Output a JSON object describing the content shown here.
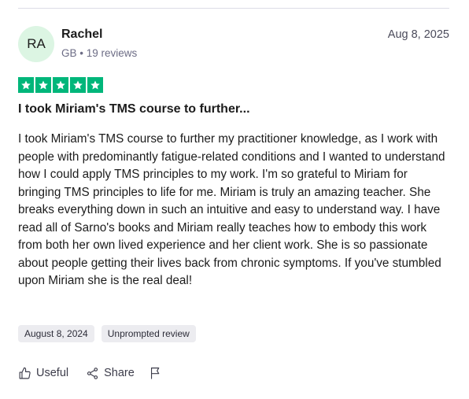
{
  "review": {
    "reviewer": {
      "initials": "RA",
      "name": "Rachel",
      "meta": "GB • 19 reviews"
    },
    "date": "Aug 8, 2025",
    "rating": 5,
    "title": "I took Miriam's TMS course to further...",
    "body": "I took Miriam's TMS course to further my practitioner knowledge, as I work with people with predominantly fatigue-related conditions and I wanted to understand how I could apply TMS principles to my work. I'm so grateful to Miriam for bringing TMS principles to life for me. Miriam is truly an amazing teacher. She breaks everything down in such an intuitive and easy to understand way. I have read all of Sarno's books and Miriam really teaches how to embody this work from both her own lived experience and her client work. She is so passionate about people getting their lives back from chronic symptoms. If you've stumbled upon Miriam she is the real deal!",
    "tags": [
      "August 8, 2024",
      "Unprompted review"
    ],
    "actions": {
      "useful_label": "Useful",
      "share_label": "Share"
    }
  },
  "colors": {
    "star_green": "#00b67a",
    "avatar_bg": "#dcf5e3",
    "tag_bg": "#ececf0"
  },
  "icons": {
    "useful": "thumbs-up-icon",
    "share": "share-icon",
    "report": "flag-icon",
    "star": "star-icon"
  }
}
